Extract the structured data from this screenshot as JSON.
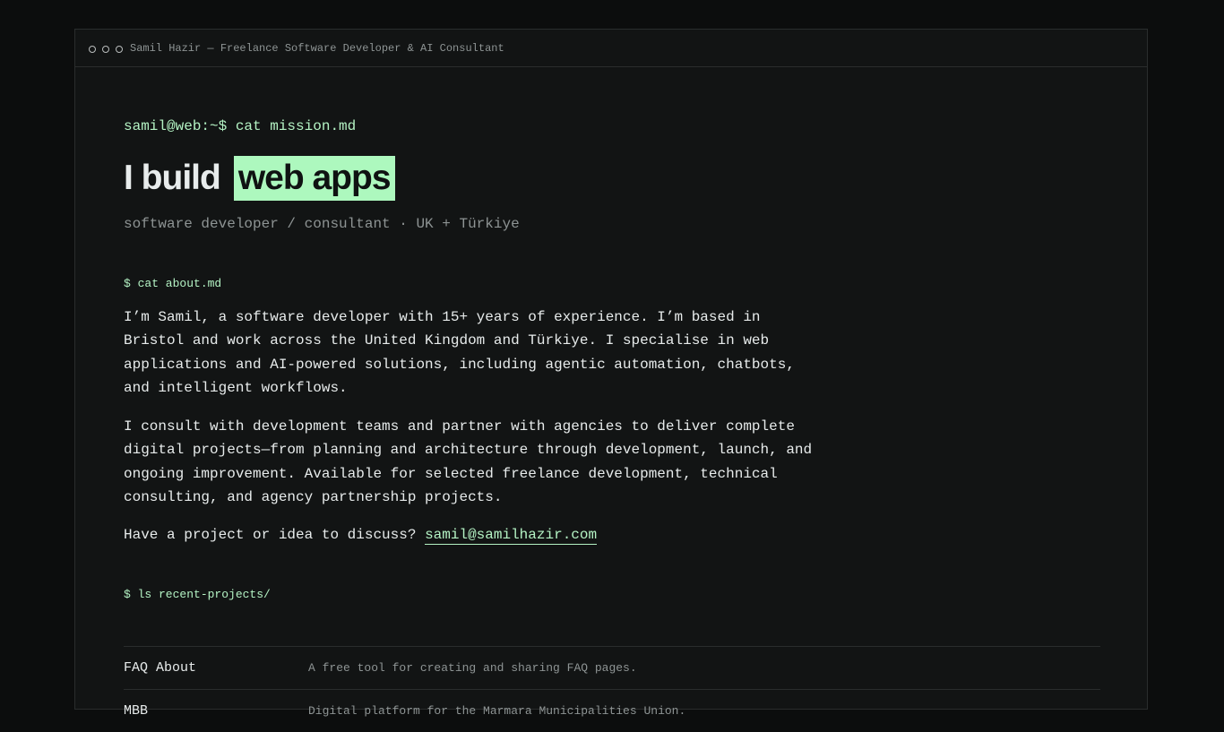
{
  "window": {
    "title": "Samil Hazir — Freelance Software Developer & AI Consultant"
  },
  "hero": {
    "prompt": "samil@web:~$ cat mission.md",
    "headline_prefix": "I build",
    "headline_highlight": "web apps",
    "subtitle": "software developer / consultant · UK + Türkiye"
  },
  "about": {
    "command": "$ cat about.md",
    "paragraph1": "I’m Samil, a software developer with 15+ years of experience. I’m based in Bristol and work across the United Kingdom and Türkiye. I specialise in web applications and AI-powered solutions, including agentic automation, chatbots, and intelligent workflows.",
    "paragraph2": "I consult with development teams and partner with agencies to deliver complete digital projects—from planning and architecture through development, launch, and ongoing improvement. Available for selected freelance development, technical consulting, and agency partnership projects.",
    "contact_prompt": "Have a project or idea to discuss?",
    "email": "samil@samilhazir.com"
  },
  "projects": {
    "command": "$ ls recent-projects/",
    "items": [
      {
        "name": "FAQ About",
        "description": "A free tool for creating and sharing FAQ pages."
      },
      {
        "name": "MBB",
        "description": "Digital platform for the Marmara Municipalities Union."
      }
    ]
  },
  "colors": {
    "accent": "#adf8be",
    "background": "#121414",
    "text": "#e7ebeb",
    "muted": "#8e9494"
  }
}
